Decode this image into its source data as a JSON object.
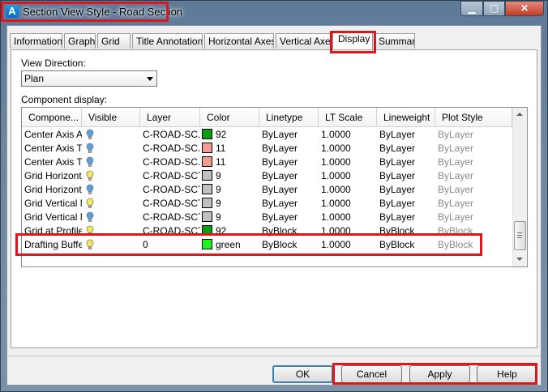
{
  "window": {
    "title": "Section View Style - Road Section",
    "app_icon_letter": "A"
  },
  "caption_buttons": {
    "minimize": "▁",
    "maximize": "▢",
    "close": "✕"
  },
  "tabs": [
    {
      "label": "Information"
    },
    {
      "label": "Graph"
    },
    {
      "label": "Grid"
    },
    {
      "label": "Title Annotation"
    },
    {
      "label": "Horizontal Axes"
    },
    {
      "label": "Vertical Axes"
    },
    {
      "label": "Display",
      "active": true
    },
    {
      "label": "Summary"
    }
  ],
  "view_direction": {
    "label": "View Direction:",
    "value": "Plan"
  },
  "component_display": {
    "label": "Component display:",
    "columns": [
      "Compone...",
      "Visible",
      "Layer",
      "Color",
      "Linetype",
      "LT Scale",
      "Lineweight",
      "Plot Style"
    ],
    "rows": [
      {
        "component": "Center Axis Ar",
        "visible": "off",
        "layer": "C-ROAD-SC...",
        "color_name": "92",
        "color_hex": "#0a9e12",
        "linetype": "ByLayer",
        "lt_scale": "1.0000",
        "lineweight": "ByLayer",
        "plot_style": "ByLayer"
      },
      {
        "component": "Center Axis Tic",
        "visible": "off",
        "layer": "C-ROAD-SC...",
        "color_name": "11",
        "color_hex": "#f49a92",
        "linetype": "ByLayer",
        "lt_scale": "1.0000",
        "lineweight": "ByLayer",
        "plot_style": "ByLayer"
      },
      {
        "component": "Center Axis Tic",
        "visible": "off",
        "layer": "C-ROAD-SC...",
        "color_name": "11",
        "color_hex": "#f49a92",
        "linetype": "ByLayer",
        "lt_scale": "1.0000",
        "lineweight": "ByLayer",
        "plot_style": "ByLayer"
      },
      {
        "component": "Grid Horizontal",
        "visible": "on",
        "layer": "C-ROAD-SCTN",
        "color_name": "9",
        "color_hex": "#c0c0c0",
        "linetype": "ByLayer",
        "lt_scale": "1.0000",
        "lineweight": "ByLayer",
        "plot_style": "ByLayer"
      },
      {
        "component": "Grid Horizontal",
        "visible": "off",
        "layer": "C-ROAD-SCTN",
        "color_name": "9",
        "color_hex": "#c0c0c0",
        "linetype": "ByLayer",
        "lt_scale": "1.0000",
        "lineweight": "ByLayer",
        "plot_style": "ByLayer"
      },
      {
        "component": "Grid Vertical Ma",
        "visible": "on",
        "layer": "C-ROAD-SCTN",
        "color_name": "9",
        "color_hex": "#c0c0c0",
        "linetype": "ByLayer",
        "lt_scale": "1.0000",
        "lineweight": "ByLayer",
        "plot_style": "ByLayer"
      },
      {
        "component": "Grid Vertical Mi",
        "visible": "off",
        "layer": "C-ROAD-SCTN",
        "color_name": "9",
        "color_hex": "#c0c0c0",
        "linetype": "ByLayer",
        "lt_scale": "1.0000",
        "lineweight": "ByLayer",
        "plot_style": "ByLayer"
      },
      {
        "component": "Grid at Profile C",
        "visible": "on",
        "layer": "C-ROAD-SCTN",
        "color_name": "92",
        "color_hex": "#0a9e12",
        "linetype": "ByBlock",
        "lt_scale": "1.0000",
        "lineweight": "ByBlock",
        "plot_style": "ByBlock"
      },
      {
        "component": "Drafting Buffer",
        "visible": "on",
        "layer": "0",
        "color_name": "green",
        "color_hex": "#1ef51e",
        "linetype": "ByBlock",
        "lt_scale": "1.0000",
        "lineweight": "ByBlock",
        "plot_style": "ByBlock"
      }
    ]
  },
  "buttons": {
    "ok": "OK",
    "cancel": "Cancel",
    "apply": "Apply",
    "help": "Help"
  },
  "colors": {
    "highlight": "#e0161d",
    "bulb_on": "#f3e85a",
    "bulb_off": "#5aa0dc"
  }
}
